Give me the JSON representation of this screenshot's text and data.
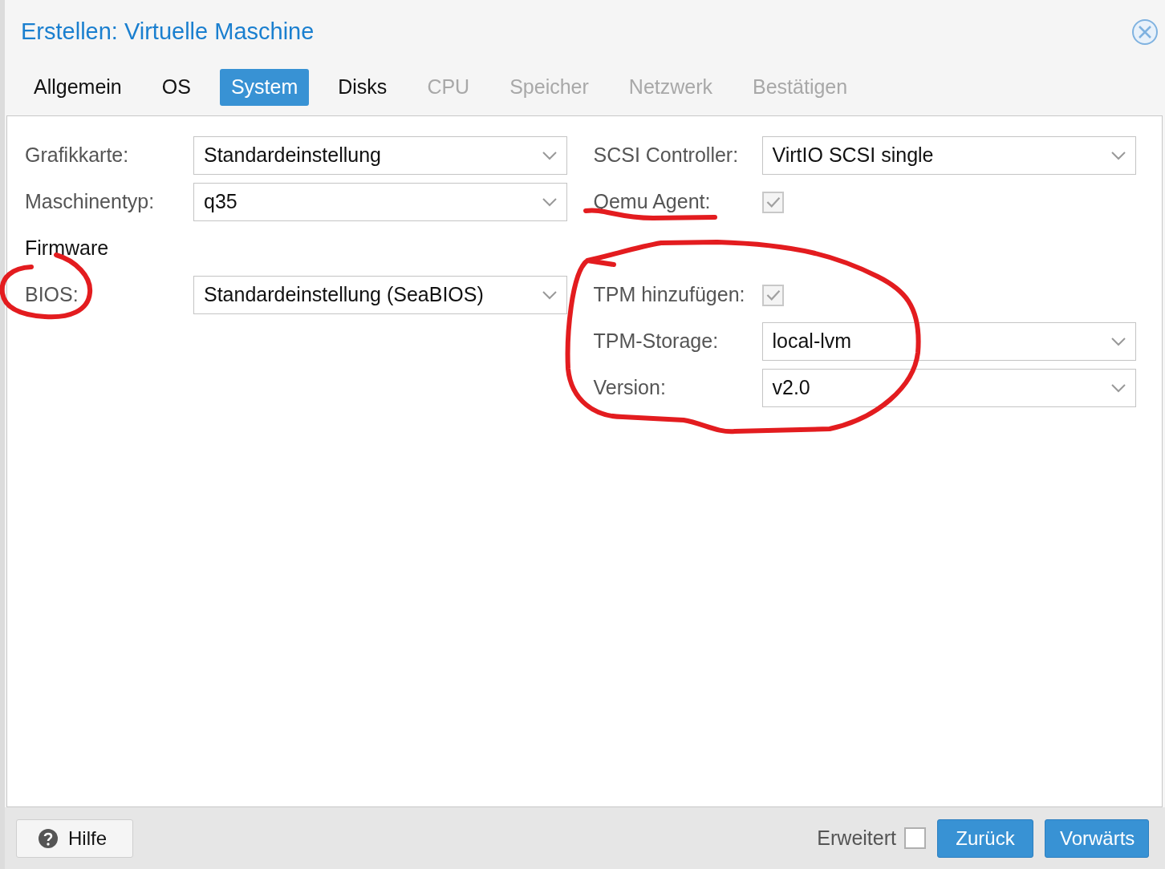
{
  "dialog": {
    "title": "Erstellen: Virtuelle Maschine"
  },
  "tabs": [
    {
      "label": "Allgemein",
      "selected": false,
      "disabled": false
    },
    {
      "label": "OS",
      "selected": false,
      "disabled": false
    },
    {
      "label": "System",
      "selected": true,
      "disabled": false
    },
    {
      "label": "Disks",
      "selected": false,
      "disabled": false
    },
    {
      "label": "CPU",
      "selected": false,
      "disabled": true
    },
    {
      "label": "Speicher",
      "selected": false,
      "disabled": true
    },
    {
      "label": "Netzwerk",
      "selected": false,
      "disabled": true
    },
    {
      "label": "Bestätigen",
      "selected": false,
      "disabled": true
    }
  ],
  "rows": [
    {
      "left": {
        "kind": "combo",
        "label": "Grafikkarte:",
        "value": "Standardeinstellung"
      },
      "right": {
        "kind": "combo",
        "label": "SCSI Controller:",
        "value": "VirtIO SCSI single"
      }
    },
    {
      "left": {
        "kind": "combo",
        "label": "Maschinentyp:",
        "value": "q35"
      },
      "right": {
        "kind": "checkbox",
        "label": "Qemu Agent:",
        "checked": true,
        "disabled": true
      }
    },
    {
      "left": {
        "kind": "heading",
        "label": "Firmware"
      }
    },
    {
      "left": {
        "kind": "combo",
        "label": "BIOS:",
        "value": "Standardeinstellung (SeaBIOS)"
      },
      "right": {
        "kind": "checkbox",
        "label": "TPM hinzufügen:",
        "checked": true,
        "disabled": true
      }
    },
    {
      "right": {
        "kind": "combo",
        "label": "TPM-Storage:",
        "value": "local-lvm"
      }
    },
    {
      "right": {
        "kind": "combo",
        "label": "Version:",
        "value": "v2.0"
      }
    }
  ],
  "footer": {
    "help": "Hilfe",
    "advanced": {
      "label": "Erweitert",
      "checked": false
    },
    "back": "Zurück",
    "next": "Vorwärts"
  }
}
